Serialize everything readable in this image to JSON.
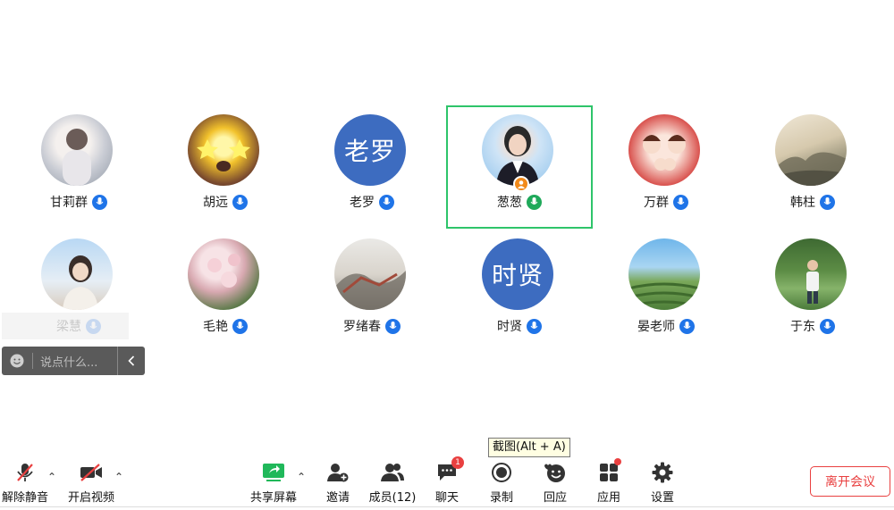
{
  "participants": [
    {
      "name": "甘莉群",
      "avatar_type": "photo",
      "mic": "on"
    },
    {
      "name": "胡远",
      "avatar_type": "photo",
      "mic": "on"
    },
    {
      "name": "老罗",
      "avatar_type": "text",
      "avatar_text": "老罗",
      "mic": "on"
    },
    {
      "name": "葱葱",
      "avatar_type": "photo",
      "mic": "speaking",
      "active": true,
      "host": true
    },
    {
      "name": "万群",
      "avatar_type": "photo",
      "mic": "on"
    },
    {
      "name": "韩柱",
      "avatar_type": "photo",
      "mic": "on"
    },
    {
      "name": "梁慧",
      "avatar_type": "photo",
      "mic": "on"
    },
    {
      "name": "毛艳",
      "avatar_type": "photo",
      "mic": "on"
    },
    {
      "name": "罗绪春",
      "avatar_type": "photo",
      "mic": "on"
    },
    {
      "name": "时贤",
      "avatar_type": "text",
      "avatar_text": "时贤",
      "mic": "on"
    },
    {
      "name": "晏老师",
      "avatar_type": "photo",
      "mic": "on"
    },
    {
      "name": "于东",
      "avatar_type": "photo",
      "mic": "on"
    }
  ],
  "chat": {
    "placeholder": "说点什么...",
    "emoji_icon": "smile-icon",
    "collapse_icon": "chevron-left-icon"
  },
  "tooltip": "截图(Alt + A)",
  "toolbar": {
    "unmute": "解除静音",
    "start_video": "开启视频",
    "share_screen": "共享屏幕",
    "invite": "邀请",
    "members": "成员(12)",
    "chat": "聊天",
    "chat_badge": "1",
    "record": "录制",
    "reactions": "回应",
    "apps": "应用",
    "settings": "设置",
    "leave": "离开会议"
  },
  "colors": {
    "accent": "#1f74e8",
    "speaking": "#1fa95a",
    "active_border": "#2ec46a",
    "text_avatar": "#3d6cc0",
    "danger": "#e94040",
    "share_green": "#20b85a"
  }
}
